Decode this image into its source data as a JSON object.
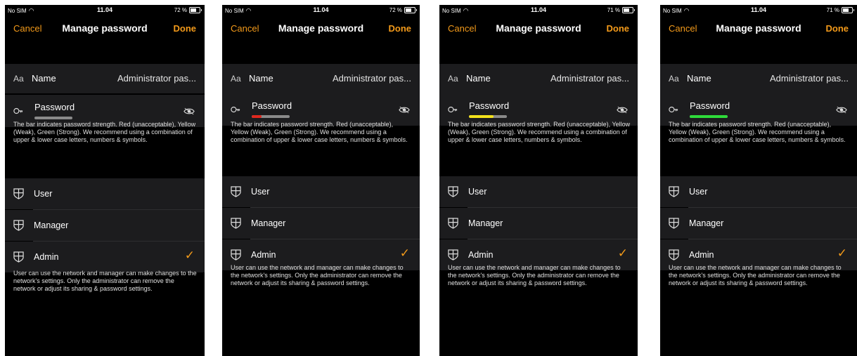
{
  "status": {
    "carrier": "No SIM",
    "time": "11.04"
  },
  "nav": {
    "cancel": "Cancel",
    "title": "Manage password",
    "done": "Done"
  },
  "name_row": {
    "prefix": "Aa",
    "label": "Name",
    "value": "Administrator pas..."
  },
  "password_row": {
    "label": "Password"
  },
  "strength_description": "The bar indicates password strength. Red (unacceptable), Yellow (Weak), Green (Strong). We recommend using a combination of upper & lower case letters, numbers & symbols.",
  "roles": [
    {
      "label": "User",
      "selected": false
    },
    {
      "label": "Manager",
      "selected": false
    },
    {
      "label": "Admin",
      "selected": true
    }
  ],
  "role_description": "User can use the network and manager can make changes to the network's settings. Only the administrator can remove the network or adjust its sharing & password settings.",
  "icons": {
    "check": "✓",
    "shield": "shield-icon",
    "key": "key-icon",
    "eye": "eye-icon"
  },
  "colors": {
    "accent": "#f39a1a",
    "red": "#e0281e",
    "yellow": "#f3e21c",
    "green": "#2edb3a",
    "bar_empty": "#8a8a8a"
  },
  "screens": [
    {
      "battery": "72 %",
      "strength_fill": 0,
      "strength_color": "#8a8a8a"
    },
    {
      "battery": "72 %",
      "strength_fill": 0.25,
      "strength_color": "#e0281e"
    },
    {
      "battery": "71 %",
      "strength_fill": 0.65,
      "strength_color": "#f3e21c"
    },
    {
      "battery": "71 %",
      "strength_fill": 1.0,
      "strength_color": "#2edb3a"
    }
  ]
}
